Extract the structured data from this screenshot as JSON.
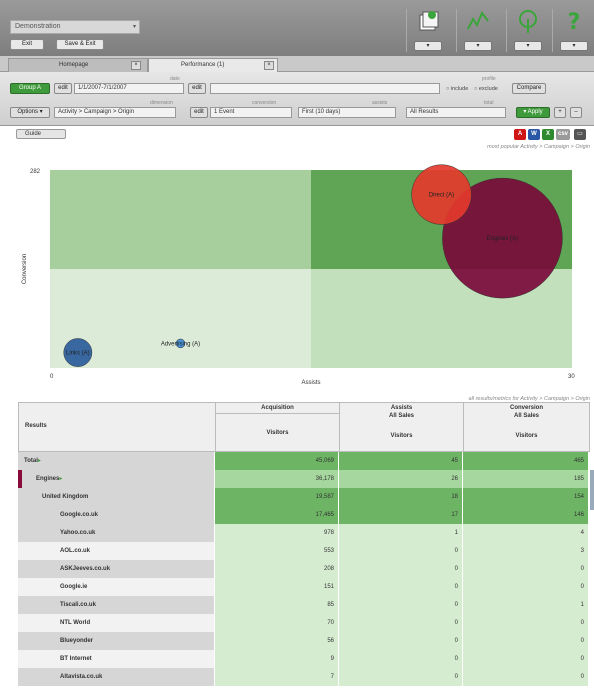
{
  "header": {
    "report_select": "Demonstration",
    "exit_label": "Exit",
    "save_exit_label": "Save & Exit"
  },
  "tabs": [
    {
      "label": "Homepage"
    },
    {
      "label": "Performance (1)"
    }
  ],
  "filters": {
    "group_label": "Group A",
    "date_caption": "date",
    "date_value": "1/1/2007-7/1/2007",
    "edit_label": "edit",
    "profile_caption": "profile",
    "include_label": "include",
    "exclude_label": "exclude",
    "compare_label": "Compare",
    "options_label": "Options",
    "dimension_caption": "dimension",
    "dimension_value": "Activity > Campaign > Origin",
    "conversion_caption": "conversion",
    "conversion_value": "1 Event",
    "assists_caption": "assists",
    "assists_value": "First (10 days)",
    "total_caption": "total",
    "total_value": "All Results",
    "apply_label": "Apply"
  },
  "guide": {
    "label": "Guide",
    "breadcrumb": "most popular Activity > Campaign > Origin"
  },
  "chart_data": {
    "type": "scatter",
    "xlabel": "Assists",
    "ylabel": "Conversion",
    "xlim": [
      0,
      30
    ],
    "ylim": [
      0,
      282
    ],
    "x_ticks": [
      "0",
      "30"
    ],
    "y_ticks": [
      "282"
    ],
    "series": [
      {
        "name": "Engines (A)",
        "x": 26,
        "y": 185,
        "size": 36178,
        "color": "#7a0a3a"
      },
      {
        "name": "Direct (A)",
        "x": 22.5,
        "y": 247,
        "size": 9000,
        "color": "#e33a2c"
      },
      {
        "name": "Links (A)",
        "x": 1.6,
        "y": 22,
        "size": 2000,
        "color": "#2a5c9c"
      },
      {
        "name": "Advertising (A)",
        "x": 7.5,
        "y": 35,
        "size": 200,
        "color": "#3d8ad2"
      }
    ],
    "quadrant_colors": [
      "#a7cf9e",
      "#5fa555",
      "#dcebd8",
      "#c3e0bc"
    ]
  },
  "table": {
    "caption": "all results/metrics for Activity > Campaign > Origin",
    "results_header": "Results",
    "columns": [
      {
        "top": "Acquisition",
        "sub": "",
        "metric": "Visitors"
      },
      {
        "top": "Assists",
        "sub": "All Sales",
        "metric": "Visitors"
      },
      {
        "top": "Conversion",
        "sub": "All Sales",
        "metric": "Visitors"
      }
    ],
    "rows": [
      {
        "name": "Total",
        "acq": "45,069",
        "ast": "45",
        "conv": "465",
        "style": "dark",
        "indent": 0,
        "arrow": "▸"
      },
      {
        "name": "Engines",
        "acq": "36,178",
        "ast": "26",
        "conv": "185",
        "style": "mid",
        "indent": 8,
        "arrow": "▸"
      },
      {
        "name": "United Kingdom",
        "acq": "19,587",
        "ast": "18",
        "conv": "154",
        "style": "dark",
        "indent": 18,
        "arrow": ""
      },
      {
        "name": "Google.co.uk",
        "acq": "17,465",
        "ast": "17",
        "conv": "146",
        "style": "dark",
        "indent": 36,
        "arrow": ""
      },
      {
        "name": "Yahoo.co.uk",
        "acq": "978",
        "ast": "1",
        "conv": "4",
        "style": "light",
        "indent": 36,
        "arrow": ""
      },
      {
        "name": "AOL.co.uk",
        "acq": "553",
        "ast": "0",
        "conv": "3",
        "style": "light",
        "indent": 36,
        "arrow": ""
      },
      {
        "name": "ASKJeeves.co.uk",
        "acq": "208",
        "ast": "0",
        "conv": "0",
        "style": "light",
        "indent": 36,
        "arrow": ""
      },
      {
        "name": "Google.ie",
        "acq": "151",
        "ast": "0",
        "conv": "0",
        "style": "light",
        "indent": 36,
        "arrow": ""
      },
      {
        "name": "Tiscali.co.uk",
        "acq": "85",
        "ast": "0",
        "conv": "1",
        "style": "light",
        "indent": 36,
        "arrow": ""
      },
      {
        "name": "NTL World",
        "acq": "70",
        "ast": "0",
        "conv": "0",
        "style": "light",
        "indent": 36,
        "arrow": ""
      },
      {
        "name": "Blueyonder",
        "acq": "56",
        "ast": "0",
        "conv": "0",
        "style": "light",
        "indent": 36,
        "arrow": ""
      },
      {
        "name": "BT Internet",
        "acq": "9",
        "ast": "0",
        "conv": "0",
        "style": "light",
        "indent": 36,
        "arrow": ""
      },
      {
        "name": "Altavista.co.uk",
        "acq": "7",
        "ast": "0",
        "conv": "0",
        "style": "light",
        "indent": 36,
        "arrow": ""
      }
    ]
  }
}
